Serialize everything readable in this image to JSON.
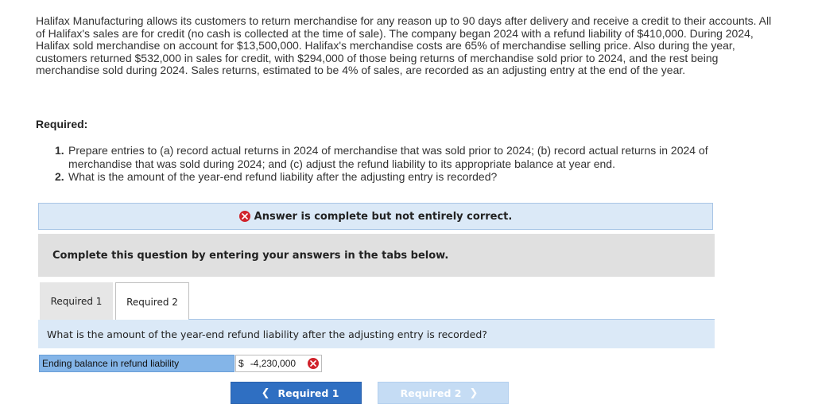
{
  "problem": {
    "paragraph": "Halifax Manufacturing allows its customers to return merchandise for any reason up to 90 days after delivery and receive a credit to their accounts. All of Halifax's sales are for credit (no cash is collected at the time of sale). The company began 2024 with a refund liability of $410,000. During 2024, Halifax sold merchandise on account for $13,500,000. Halifax's merchandise costs are 65% of merchandise selling price. Also during the year, customers returned $532,000 in sales for credit, with $294,000 of those being returns of merchandise sold prior to 2024, and the rest being merchandise sold during 2024. Sales returns, estimated to be 4% of sales, are recorded as an adjusting entry at the end of the year."
  },
  "required": {
    "heading": "Required:",
    "items": [
      {
        "num": "1.",
        "text": "Prepare entries to (a) record actual returns in 2024 of merchandise that was sold prior to 2024; (b) record actual returns in 2024 of merchandise that was sold during 2024; and (c) adjust the refund liability to its appropriate balance at year end."
      },
      {
        "num": "2.",
        "text": "What is the amount of the year-end refund liability after the adjusting entry is recorded?"
      }
    ]
  },
  "alert": {
    "text": "Answer is complete but not entirely correct.",
    "icon": "x-circle-icon",
    "color": "#d0222b"
  },
  "instruction": "Complete this question by entering your answers in the tabs below.",
  "tabs": [
    {
      "label": "Required 1",
      "active": false
    },
    {
      "label": "Required 2",
      "active": true
    }
  ],
  "question": "What is the amount of the year-end refund liability after the adjusting entry is recorded?",
  "answer_row": {
    "label": "Ending balance in refund liability",
    "currency": "$",
    "value": "-4,230,000",
    "status": "incorrect"
  },
  "nav": {
    "prev_label": "Required 1",
    "next_label": "Required 2",
    "prev_color": "#2f6fc2",
    "next_color": "#c5dcf4"
  }
}
